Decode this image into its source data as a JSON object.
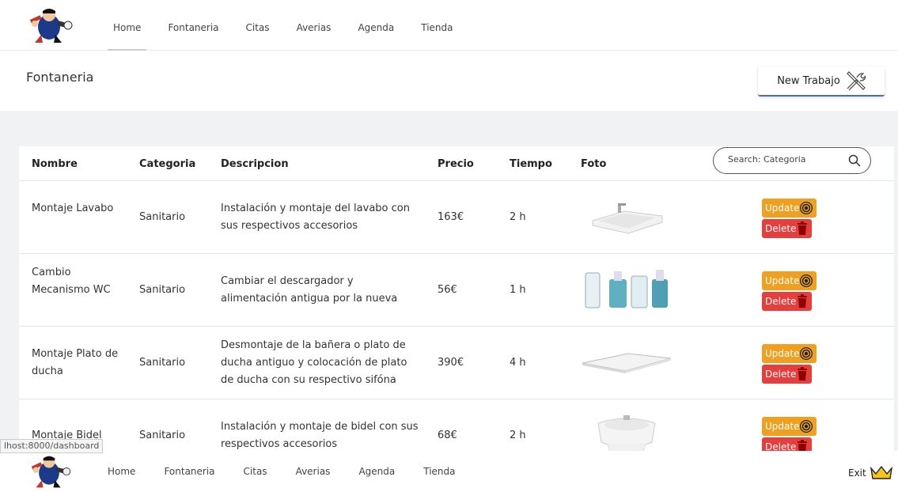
{
  "nav": {
    "links": [
      "Home",
      "Fontaneria",
      "Citas",
      "Averias",
      "Agenda",
      "Tienda"
    ]
  },
  "header": {
    "title": "Fontaneria",
    "new_button": "New Trabajo"
  },
  "table": {
    "columns": [
      "Nombre",
      "Categoria",
      "Descripcion",
      "Precio",
      "Tiempo",
      "Foto"
    ],
    "search_placeholder": "Search: Categoria",
    "update_label": "Update",
    "delete_label": "Delete",
    "rows": [
      {
        "nombre": "Montaje Lavabo",
        "categoria": "Sanitario",
        "descripcion": "Instalación y montaje del lavabo con sus respectivos accesorios",
        "precio": "163€",
        "tiempo": "2 h",
        "foto": "washbasin"
      },
      {
        "nombre": "Cambio Mecanismo WC",
        "categoria": "Sanitario",
        "descripcion": "Cambiar el descargador y alimentación antigua por la nueva",
        "precio": "56€",
        "tiempo": "1 h",
        "foto": "flush-mechanisms"
      },
      {
        "nombre": "Montaje Plato de ducha",
        "categoria": "Sanitario",
        "descripcion": "Desmontaje de la bañera o plato de ducha antiguo y colocación de plato de ducha con su respectivo sifóna",
        "precio": "390€",
        "tiempo": "4 h",
        "foto": "shower-tray"
      },
      {
        "nombre": "Montaje Bidel",
        "categoria": "Sanitario",
        "descripcion": "Instalación y montaje de bidel con sus respectivos accesorios",
        "precio": "68€",
        "tiempo": "2 h",
        "foto": "bidet"
      }
    ]
  },
  "status_url": "lhost:8000/dashboard",
  "footer": {
    "links": [
      "Home",
      "Fontaneria",
      "Citas",
      "Averias",
      "Agenda",
      "Tienda"
    ],
    "exit_label": "Exit"
  },
  "colors": {
    "update": "#f0a020",
    "delete": "#e63d3d",
    "accent": "#4a6fb5",
    "background": "#f1f2f4"
  }
}
